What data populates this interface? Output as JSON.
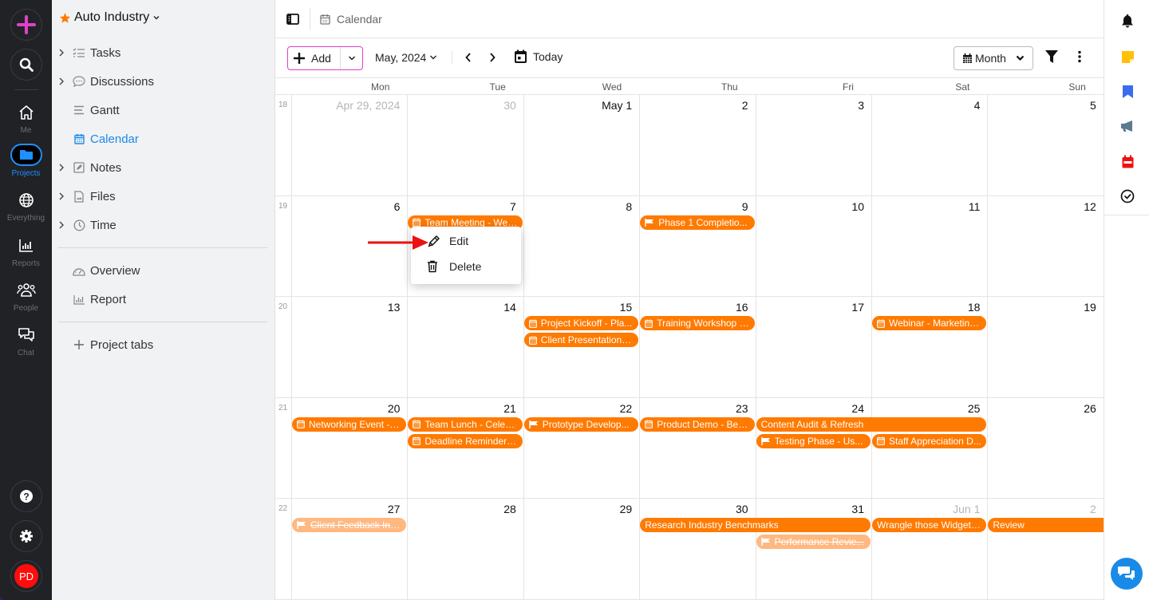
{
  "rail": {
    "items": [
      {
        "id": "me",
        "label": "Me"
      },
      {
        "id": "projects",
        "label": "Projects"
      },
      {
        "id": "everything",
        "label": "Everything"
      },
      {
        "id": "reports",
        "label": "Reports"
      },
      {
        "id": "people",
        "label": "People"
      },
      {
        "id": "chat",
        "label": "Chat"
      }
    ],
    "avatar_initials": "PD",
    "colors": {
      "accent": "#1e90ff",
      "create": "#e040c8",
      "avatar": "#ff0d0d"
    }
  },
  "sidebar": {
    "project_name": "Auto Industry",
    "items": [
      {
        "label": "Tasks",
        "icon": "checklist-icon",
        "expandable": true
      },
      {
        "label": "Discussions",
        "icon": "chat-bubble-icon",
        "expandable": true
      },
      {
        "label": "Gantt",
        "icon": "gantt-icon",
        "expandable": false
      },
      {
        "label": "Calendar",
        "icon": "calendar-icon",
        "expandable": false,
        "active": true
      },
      {
        "label": "Notes",
        "icon": "note-icon",
        "expandable": true
      },
      {
        "label": "Files",
        "icon": "file-icon",
        "expandable": true
      },
      {
        "label": "Time",
        "icon": "clock-icon",
        "expandable": true
      }
    ],
    "secondary": [
      {
        "label": "Overview",
        "icon": "gauge-icon"
      },
      {
        "label": "Report",
        "icon": "bar-chart-icon"
      }
    ],
    "add_tabs_label": "Project tabs"
  },
  "header": {
    "breadcrumb": "Calendar"
  },
  "toolbar": {
    "add_label": "Add",
    "month_label": "May, 2024",
    "today_label": "Today",
    "view_label": "Month"
  },
  "calendar": {
    "weekdays": [
      "Mon",
      "Tue",
      "Wed",
      "Thu",
      "Fri",
      "Sat",
      "Sun"
    ],
    "weeks": [
      {
        "num": "18",
        "days": [
          {
            "label": "Apr 29, 2024",
            "muted": true
          },
          {
            "label": "30",
            "muted": true
          },
          {
            "label": "May 1"
          },
          {
            "label": "2"
          },
          {
            "label": "3"
          },
          {
            "label": "4"
          },
          {
            "label": "5"
          }
        ]
      },
      {
        "num": "19",
        "days": [
          {
            "label": "6"
          },
          {
            "label": "7"
          },
          {
            "label": "8"
          },
          {
            "label": "9"
          },
          {
            "label": "10"
          },
          {
            "label": "11"
          },
          {
            "label": "12"
          }
        ]
      },
      {
        "num": "20",
        "days": [
          {
            "label": "13"
          },
          {
            "label": "14"
          },
          {
            "label": "15"
          },
          {
            "label": "16"
          },
          {
            "label": "17"
          },
          {
            "label": "18"
          },
          {
            "label": "19"
          }
        ]
      },
      {
        "num": "21",
        "days": [
          {
            "label": "20"
          },
          {
            "label": "21"
          },
          {
            "label": "22"
          },
          {
            "label": "23"
          },
          {
            "label": "24"
          },
          {
            "label": "25"
          },
          {
            "label": "26"
          }
        ]
      },
      {
        "num": "22",
        "days": [
          {
            "label": "27"
          },
          {
            "label": "28"
          },
          {
            "label": "29"
          },
          {
            "label": "30"
          },
          {
            "label": "31"
          },
          {
            "label": "Jun 1",
            "muted": true
          },
          {
            "label": "2",
            "muted": true
          }
        ]
      }
    ],
    "events": [
      {
        "title": "Team Meeting - Wee...",
        "icon": "calendar",
        "week": 1,
        "day": 1,
        "span": 1,
        "row": 0
      },
      {
        "title": "Phase 1 Completio...",
        "icon": "flag",
        "week": 1,
        "day": 3,
        "span": 1,
        "row": 0
      },
      {
        "title": "Project Kickoff - Pla...",
        "icon": "calendar",
        "week": 2,
        "day": 2,
        "span": 1,
        "row": 0
      },
      {
        "title": "Client Presentation -...",
        "icon": "calendar",
        "week": 2,
        "day": 2,
        "span": 1,
        "row": 1
      },
      {
        "title": "Training Workshop - ...",
        "icon": "calendar",
        "week": 2,
        "day": 3,
        "span": 1,
        "row": 0
      },
      {
        "title": "Webinar - Marketing ...",
        "icon": "calendar",
        "week": 2,
        "day": 5,
        "span": 1,
        "row": 0
      },
      {
        "title": "Networking Event - I...",
        "icon": "calendar",
        "week": 3,
        "day": 0,
        "span": 1,
        "row": 0
      },
      {
        "title": "Team Lunch - Celebr...",
        "icon": "calendar",
        "week": 3,
        "day": 1,
        "span": 1,
        "row": 0
      },
      {
        "title": "Deadline Reminder - ...",
        "icon": "calendar",
        "week": 3,
        "day": 1,
        "span": 1,
        "row": 1
      },
      {
        "title": "Prototype Develop...",
        "icon": "flag",
        "week": 3,
        "day": 2,
        "span": 1,
        "row": 0
      },
      {
        "title": "Product Demo - Beta...",
        "icon": "calendar",
        "week": 3,
        "day": 3,
        "span": 1,
        "row": 0
      },
      {
        "title": "Content Audit & Refresh",
        "icon": "",
        "week": 3,
        "day": 4,
        "span": 2,
        "row": 0
      },
      {
        "title": "Testing Phase - Us...",
        "icon": "flag",
        "week": 3,
        "day": 4,
        "span": 1,
        "row": 1
      },
      {
        "title": "Staff Appreciation D...",
        "icon": "calendar",
        "week": 3,
        "day": 5,
        "span": 1,
        "row": 1
      },
      {
        "title": "Client Feedback Inc...",
        "icon": "flag",
        "week": 4,
        "day": 0,
        "span": 1,
        "row": 0,
        "done": true
      },
      {
        "title": "Research Industry Benchmarks",
        "icon": "",
        "week": 4,
        "day": 3,
        "span": 2,
        "row": 0
      },
      {
        "title": "Performance Revie...",
        "icon": "flag",
        "week": 4,
        "day": 4,
        "span": 1,
        "row": 1,
        "done": true
      },
      {
        "title": "Wrangle those Widgets...",
        "icon": "",
        "week": 4,
        "day": 5,
        "span": 1,
        "row": 0
      },
      {
        "title": "Review",
        "icon": "",
        "week": 4,
        "day": 6,
        "span": 1,
        "row": 0,
        "continues": true
      }
    ],
    "event_color": "#ff7a00",
    "event_done_color": "#ffb880"
  },
  "context_menu": {
    "items": [
      {
        "label": "Edit",
        "icon": "pencil-icon"
      },
      {
        "label": "Delete",
        "icon": "trash-icon"
      }
    ]
  },
  "right_rail": {
    "icons": [
      "bell-icon",
      "sticky-note-icon",
      "bookmark-icon",
      "megaphone-icon",
      "calendar-red-icon",
      "clock-check-icon"
    ]
  }
}
